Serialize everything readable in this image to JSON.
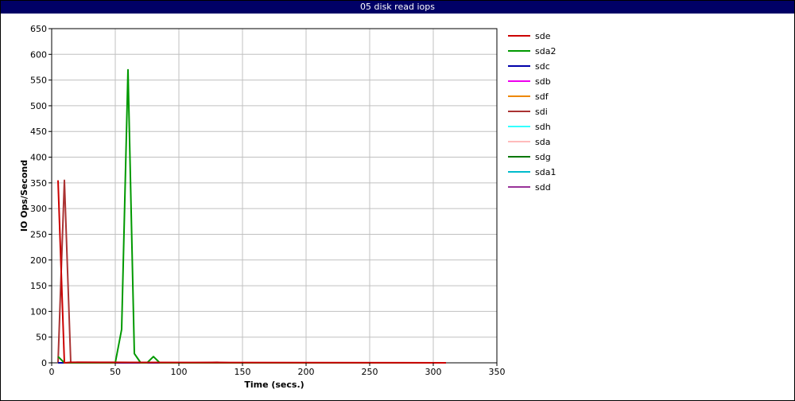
{
  "chart_data": {
    "type": "line",
    "title": "05 disk read iops",
    "xlabel": "Time (secs.)",
    "ylabel": "IO Ops/Second",
    "xlim": [
      0,
      350
    ],
    "ylim": [
      0,
      650
    ],
    "xticks": [
      0,
      50,
      100,
      150,
      200,
      250,
      300,
      350
    ],
    "yticks": [
      0,
      50,
      100,
      150,
      200,
      250,
      300,
      350,
      400,
      450,
      500,
      550,
      600,
      650
    ],
    "grid": true,
    "legend": "right",
    "series": [
      {
        "name": "sde",
        "color": "#cc0000",
        "x": [
          5,
          10,
          15,
          20,
          310
        ],
        "y": [
          355,
          0,
          1,
          1,
          0
        ]
      },
      {
        "name": "sda2",
        "color": "#009900",
        "x": [
          5,
          10,
          45,
          50,
          55,
          60,
          65,
          70,
          75,
          80,
          85,
          100,
          310
        ],
        "y": [
          12,
          0,
          0,
          0,
          65,
          570,
          18,
          0,
          0,
          12,
          0,
          0,
          0
        ]
      },
      {
        "name": "sdc",
        "color": "#0000aa",
        "x": [
          5,
          310
        ],
        "y": [
          0,
          0
        ]
      },
      {
        "name": "sdb",
        "color": "#ee00ee",
        "x": [
          5,
          310
        ],
        "y": [
          0,
          0
        ]
      },
      {
        "name": "sdf",
        "color": "#ee8800",
        "x": [
          5,
          310
        ],
        "y": [
          0,
          0
        ]
      },
      {
        "name": "sdi",
        "color": "#aa3333",
        "x": [
          5,
          10,
          15,
          20,
          50,
          110,
          130,
          140,
          310
        ],
        "y": [
          0,
          355,
          0,
          1,
          1,
          0,
          1,
          0,
          0
        ]
      },
      {
        "name": "sdh",
        "color": "#33ffff",
        "x": [
          5,
          310
        ],
        "y": [
          0,
          0
        ]
      },
      {
        "name": "sda",
        "color": "#ffbbbb",
        "x": [
          5,
          310
        ],
        "y": [
          0,
          0
        ]
      },
      {
        "name": "sdg",
        "color": "#007700",
        "x": [
          5,
          310
        ],
        "y": [
          0,
          0
        ]
      },
      {
        "name": "sda1",
        "color": "#00bbcc",
        "x": [
          5,
          310
        ],
        "y": [
          0,
          0
        ]
      },
      {
        "name": "sdd",
        "color": "#993399",
        "x": [
          5,
          310
        ],
        "y": [
          0,
          0
        ]
      }
    ]
  }
}
